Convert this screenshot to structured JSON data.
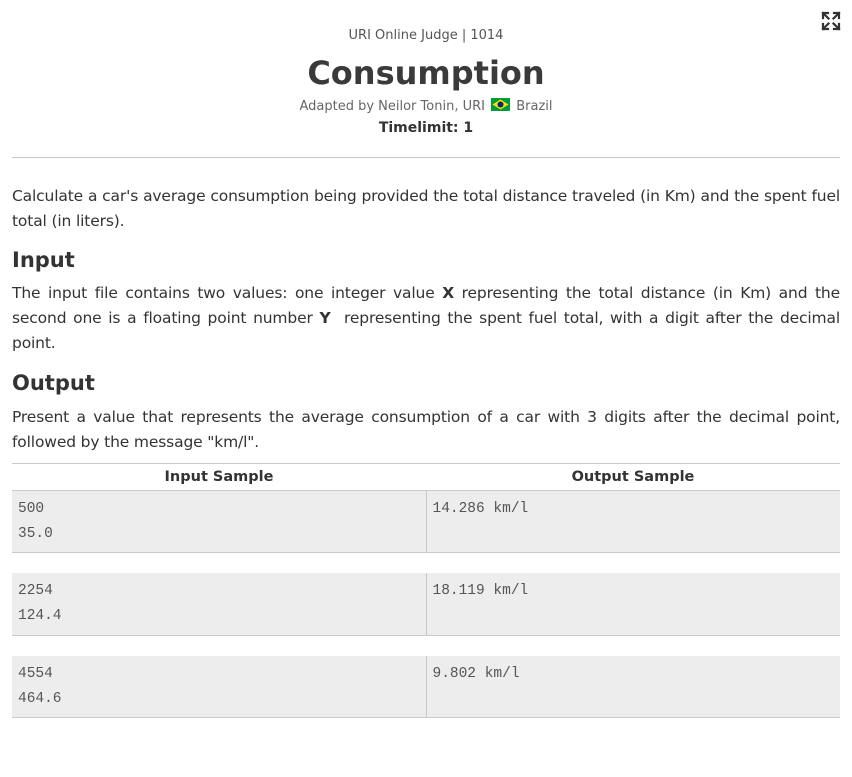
{
  "header": {
    "judge_line": "URI Online Judge | 1014",
    "title": "Consumption",
    "author_prefix": "Adapted by Neilor Tonin, URI",
    "author_country": "Brazil",
    "timelimit": "Timelimit: 1"
  },
  "icons": {
    "expand": "expand-fullscreen-icon",
    "flag": "brazil-flag-icon"
  },
  "description": "Calculate a car's average consumption being provided the total distance traveled (in Km) and the spent fuel total (in liters).",
  "input_section": {
    "title": "Input",
    "text_1": "The input file contains two values: one integer value ",
    "var_x": "X",
    "text_2": " representing the total distance (in Km) and the second one is a floating point number ",
    "var_y": "Y",
    "text_3": "  representing the spent fuel total, with a digit after the decimal point."
  },
  "output_section": {
    "title": "Output",
    "text": "Present a value that represents the average consumption of a car with 3 digits after the decimal point, followed by the message \"km/l\"."
  },
  "samples": {
    "input_header": "Input Sample",
    "output_header": "Output Sample",
    "rows": [
      {
        "input": [
          "500",
          "35.0"
        ],
        "output": [
          "14.286 km/l"
        ]
      },
      {
        "input": [
          "2254",
          "124.4"
        ],
        "output": [
          "18.119 km/l"
        ]
      },
      {
        "input": [
          "4554",
          "464.6"
        ],
        "output": [
          "9.802 km/l"
        ]
      }
    ]
  },
  "colors": {
    "text": "#333333",
    "sample_bg": "#ededed",
    "border": "#c9c9c9",
    "flag_green": "#009c3b",
    "flag_yellow": "#ffdf00",
    "flag_blue": "#002776"
  }
}
